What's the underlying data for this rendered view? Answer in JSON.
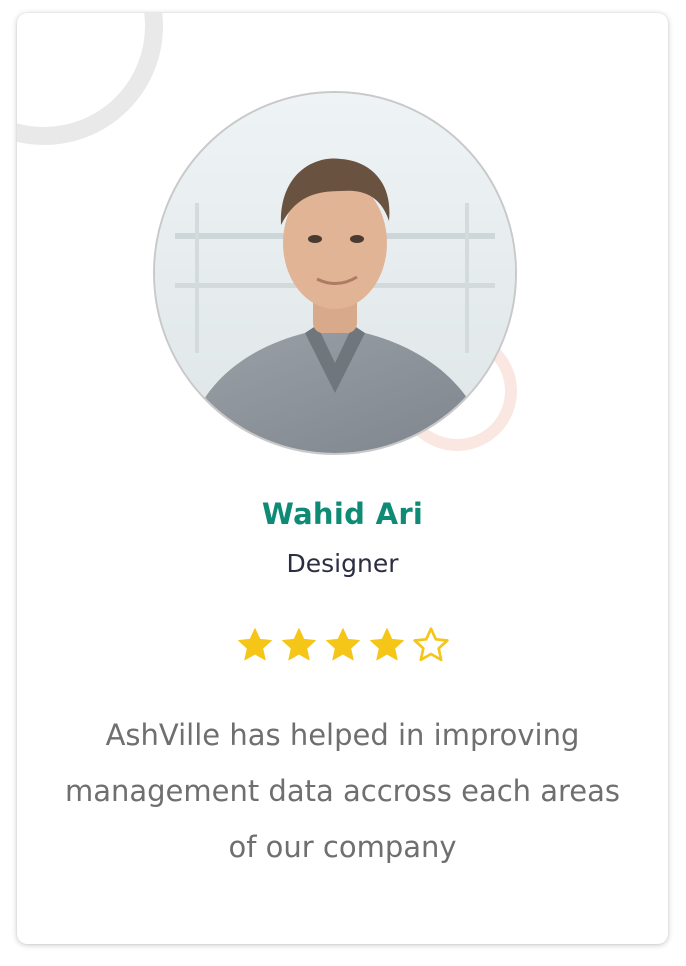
{
  "testimonial": {
    "name": "Wahid Ari",
    "role": "Designer",
    "rating": 4,
    "rating_max": 5,
    "quote": "AshVille has helped in improving management data accross each areas of our company"
  },
  "colors": {
    "name": "#0e8a75",
    "role": "#2b2d42",
    "quote": "#6f6f6f",
    "star_filled": "#f5c518",
    "star_empty_outline": "#f5c518",
    "ring_gray": "#e9e9e9",
    "ring_peach": "#fbe7e2"
  },
  "icons": {
    "star_filled": "star-filled-icon",
    "star_empty": "star-outline-icon"
  }
}
